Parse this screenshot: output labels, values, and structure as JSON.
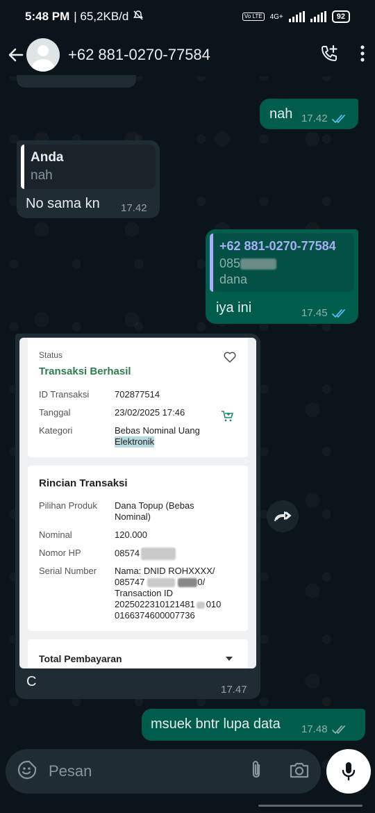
{
  "status_bar": {
    "time": "5:48 PM",
    "network_speed": "| 65,2KB/d",
    "volte": "Vo LTE",
    "network_type": "4G+",
    "battery": "92"
  },
  "header": {
    "contact": "+62 881-0270-77584"
  },
  "messages": [
    {
      "id": "m1",
      "dir": "out",
      "text": "nah",
      "time": "17.42",
      "status": "read"
    },
    {
      "id": "m2",
      "dir": "in",
      "quote_author": "Anda",
      "quote_text": "nah",
      "text": "No sama kn",
      "time": "17.42"
    },
    {
      "id": "m3",
      "dir": "out",
      "quote_author": "+62 881-0270-77584",
      "quote_line1": "085",
      "quote_line2": "dana",
      "text": "iya ini",
      "time": "17.45",
      "status": "read"
    },
    {
      "id": "m4",
      "dir": "in",
      "caption": "C",
      "time": "17.47"
    },
    {
      "id": "m5",
      "dir": "out",
      "text": "msuek bntr lupa data",
      "time": "17.48",
      "status": "delivered"
    }
  ],
  "receipt": {
    "status_label": "Status",
    "status_value": "Transaksi Berhasil",
    "rows_top": [
      {
        "label": "ID Transaksi",
        "value": "702877514"
      },
      {
        "label": "Tanggal",
        "value": "23/02/2025 17:46"
      },
      {
        "label": "Kategori",
        "value": "Bebas Nominal Uang",
        "value2": "Elektronik"
      }
    ],
    "detail_title": "Rincian Transaksi",
    "rows_detail": [
      {
        "label": "Pilihan Produk",
        "value": "Dana Topup (Bebas",
        "value2": "Nominal)"
      },
      {
        "label": "Nominal",
        "value": "120.000"
      },
      {
        "label": "Nomor HP",
        "value": "08574"
      },
      {
        "label": "Serial Number",
        "value": "Nama: DNID ROHXXXX/",
        "value2": "085747",
        "value2b": "0/",
        "value3": "Transaction ID",
        "value4": "2025022310121481",
        "value4b": "010",
        "value5": "0166374600007736"
      }
    ],
    "total_label": "Total Pembayaran"
  },
  "input": {
    "placeholder": "Pesan"
  },
  "colors": {
    "background": "#0b141a",
    "outgoing": "#005c4b",
    "incoming": "#202c33",
    "tick_read": "#53bdeb",
    "success_green": "#2e7d4f"
  }
}
